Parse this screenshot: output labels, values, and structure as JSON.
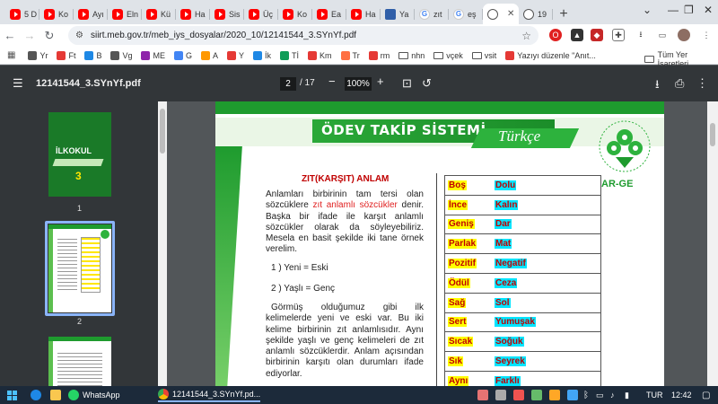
{
  "tabs": [
    {
      "label": "5 D",
      "icon": "youtube-icon"
    },
    {
      "label": "Ko",
      "icon": "youtube-icon"
    },
    {
      "label": "Ayı",
      "icon": "youtube-icon"
    },
    {
      "label": "Eln",
      "icon": "youtube-icon"
    },
    {
      "label": "Kü",
      "icon": "youtube-icon"
    },
    {
      "label": "Ha",
      "icon": "youtube-icon"
    },
    {
      "label": "Sis",
      "icon": "youtube-icon"
    },
    {
      "label": "Üç",
      "icon": "youtube-icon"
    },
    {
      "label": "Ko",
      "icon": "youtube-icon"
    },
    {
      "label": "Ea",
      "icon": "youtube-icon"
    },
    {
      "label": "Ha",
      "icon": "youtube-icon"
    },
    {
      "label": "Ya",
      "icon": "mail-icon"
    },
    {
      "label": "zıt",
      "icon": "google-icon"
    },
    {
      "label": "eş",
      "icon": "google-icon"
    },
    {
      "label": "",
      "icon": "globe-icon",
      "active": true
    },
    {
      "label": "19",
      "icon": "globe-icon"
    }
  ],
  "address_bar": {
    "url": "siirt.meb.gov.tr/meb_iys_dosyalar/2020_10/12141544_3.SYnYf.pdf"
  },
  "bookmarks": [
    {
      "label": "Yr"
    },
    {
      "label": "Ft"
    },
    {
      "label": "B"
    },
    {
      "label": "Vg"
    },
    {
      "label": "ME"
    },
    {
      "label": "G"
    },
    {
      "label": "A"
    },
    {
      "label": "Y"
    },
    {
      "label": "İk"
    },
    {
      "label": "Tİ"
    },
    {
      "label": "Km"
    },
    {
      "label": "Tr"
    },
    {
      "label": "rm"
    },
    {
      "label": "nhn"
    },
    {
      "label": "vçek"
    },
    {
      "label": "vsit"
    },
    {
      "label": "Yazıyı düzenle \"Anıt..."
    }
  ],
  "bookmarks_all": "Tüm Yer İşaretleri",
  "pdf": {
    "filename": "12141544_3.SYnYf.pdf",
    "page_current": "2",
    "page_total": "/ 17",
    "zoom": "100%"
  },
  "thumbnails": [
    {
      "label": "1",
      "cover_title": "İLKOKUL",
      "cover_num": "3"
    },
    {
      "label": "2"
    },
    {
      "label": ""
    }
  ],
  "page": {
    "header": "ÖDEV TAKİP SİSTEMİ",
    "subject": "Türkçe",
    "logo_text": "AR-GE",
    "title": "ZIT(KARŞIT) ANLAM",
    "para1_a": "Anlamları birbirinin tam tersi olan sözcüklere ",
    "para1_red": "zıt anlamlı sözcükler",
    "para1_b": " denir. Başka bir ifade ile karşıt anlamlı sözcükler olarak da söyleyebiliriz. Mesela en basit şekilde iki tane örnek verelim.",
    "ex1": "1 ) Yeni = Eski",
    "ex2": "2 ) Yaşlı = Genç",
    "para2": "Görmüş olduğumuz gibi ilk kelimelerde yeni ve eski var. Bu iki kelime birbirinin zıt anlamlısıdır. Aynı şekilde yaşlı ve genç kelimeleri de zıt anlamlı sözcüklerdir. Anlam açısından birbirinin karşıtı olan durumları ifade ediyorlar.",
    "pairs": [
      [
        "Boş",
        "Dolu"
      ],
      [
        "İnce",
        "Kalın"
      ],
      [
        "Geniş",
        "Dar"
      ],
      [
        "Parlak",
        "Mat"
      ],
      [
        "Pozitif",
        "Negatif"
      ],
      [
        "Ödül",
        "Ceza"
      ],
      [
        "Sağ",
        "Sol"
      ],
      [
        "Sert",
        "Yumuşak"
      ],
      [
        "Sıcak",
        "Soğuk"
      ],
      [
        "Sık",
        "Seyrek"
      ],
      [
        "Aynı",
        "Farklı"
      ]
    ]
  },
  "taskbar": {
    "whatsapp": "WhatsApp",
    "chrome": "12141544_3.SYnYf.pd...",
    "lang": "TUR",
    "time": "12:42"
  }
}
